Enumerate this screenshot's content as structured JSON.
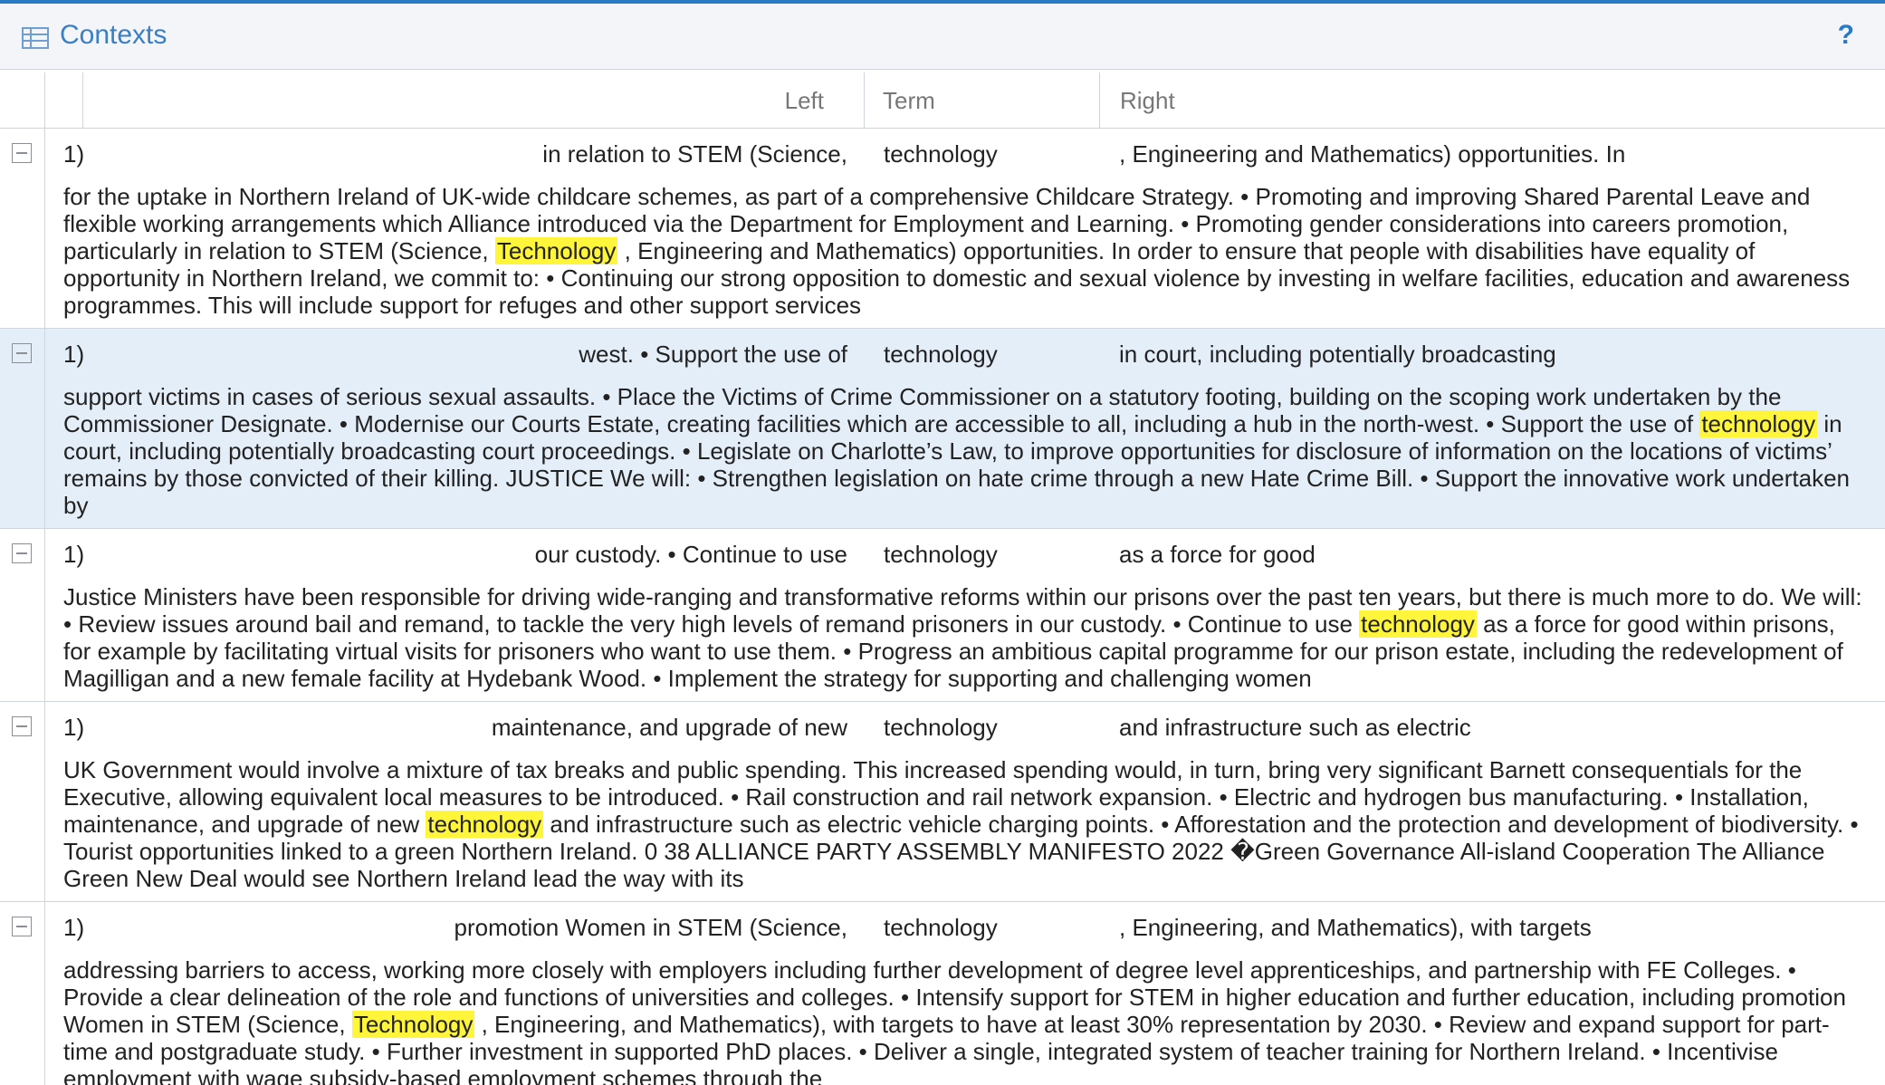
{
  "panel": {
    "title": "Contexts",
    "help_label": "?",
    "accent_color": "#2a79c5",
    "highlight_color": "#fff53a"
  },
  "columns": {
    "left": "Left",
    "term": "Term",
    "right": "Right"
  },
  "rows": [
    {
      "num": "1)",
      "left": "in relation to STEM (Science,",
      "term": "technology",
      "right": ", Engineering and Mathematics) opportunities. In",
      "context_before": "for the uptake in Northern Ireland of UK-wide childcare schemes, as part of a comprehensive Childcare Strategy. • Promoting and improving Shared Parental Leave and flexible working arrangements which Alliance introduced via the Department for Employment and Learning. • Promoting gender considerations into careers promotion, particularly in relation to STEM (Science, ",
      "context_match": "Technology",
      "context_after": " , Engineering and Mathematics) opportunities. In order to ensure that people with disabilities have equality of opportunity in Northern Ireland, we commit to: • Continuing our strong opposition to domestic and sexual violence by investing in welfare facilities, education and awareness programmes. This will include support for refuges and other support services"
    },
    {
      "num": "1)",
      "left": "west. • Support the use of",
      "term": "technology",
      "right": "in court, including potentially broadcasting",
      "context_before": "support victims in cases of serious sexual assaults. • Place the Victims of Crime Commissioner on a statutory footing, building on the scoping work undertaken by the Commissioner Designate. • Modernise our Courts Estate, creating facilities which are accessible to all, including a hub in the north-west. • Support the use of ",
      "context_match": "technology",
      "context_after": " in court, including potentially broadcasting court proceedings. • Legislate on Charlotte’s Law, to improve opportunities for disclosure of information on the locations of victims’ remains by those convicted of their killing. JUSTICE We will: • Strengthen legislation on hate crime through a new Hate Crime Bill. • Support the innovative work undertaken by"
    },
    {
      "num": "1)",
      "left": "our custody. • Continue to use",
      "term": "technology",
      "right": "as a force for good",
      "context_before": "Justice Ministers have been responsible for driving wide-ranging and transformative reforms within our prisons over the past ten years, but there is much more to do. We will: • Review issues around bail and remand, to tackle the very high levels of remand prisoners in our custody. • Continue to use ",
      "context_match": "technology",
      "context_after": " as a force for good within prisons, for example by facilitating virtual visits for prisoners who want to use them. • Progress an ambitious capital programme for our prison estate, including the redevelopment of Magilligan and a new female facility at Hydebank Wood. • Implement the strategy for supporting and challenging women"
    },
    {
      "num": "1)",
      "left": "maintenance, and upgrade of new",
      "term": "technology",
      "right": "and infrastructure such as electric",
      "context_before": "UK Government would involve a mixture of tax breaks and public spending. This increased spending would, in turn, bring very significant Barnett consequentials for the Executive, allowing equivalent local measures to be introduced. • Rail construction and rail network expansion. • Electric and hydrogen bus manufacturing. • Installation, maintenance, and upgrade of new ",
      "context_match": "technology",
      "context_after": " and infrastructure such as electric vehicle charging points. • Afforestation and the protection and development of biodiversity. • Tourist opportunities linked to a green Northern Ireland. 0 38 ALLIANCE PARTY ASSEMBLY MANIFESTO 2022 �Green Governance All-island Cooperation The Alliance Green New Deal would see Northern Ireland lead the way with its"
    },
    {
      "num": "1)",
      "left": "promotion Women in STEM (Science,",
      "term": "technology",
      "right": ", Engineering, and Mathematics), with targets",
      "context_before": "addressing barriers to access, working more closely with employers including further development of degree level apprenticeships, and partnership with FE Colleges. • Provide a clear delineation of the role and functions of universities and colleges. • Intensify support for STEM in higher education and further education, including promotion Women in STEM (Science, ",
      "context_match": "Technology",
      "context_after": " , Engineering, and Mathematics), with targets to have at least 30% representation by 2030. • Review and expand support for part-time and postgraduate study. • Further investment in supported PhD places. • Deliver a single, integrated system of teacher training for Northern Ireland. • Incentivise employment with wage subsidy-based employment schemes through the"
    }
  ]
}
